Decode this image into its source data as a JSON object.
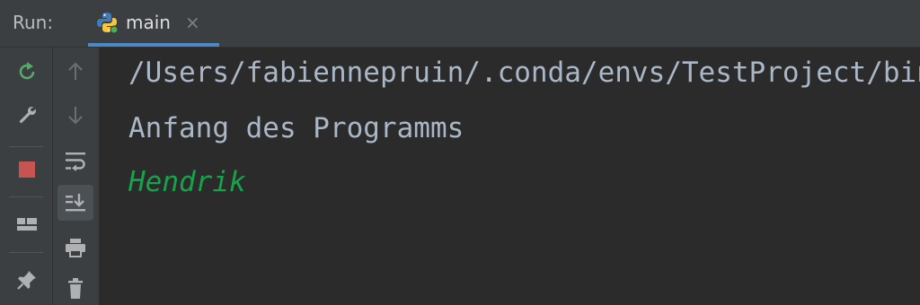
{
  "colors": {
    "console_text": "#a9b7c6",
    "user_input": "#17a34a",
    "tab_underline": "#4a88c7",
    "stop": "#c75450",
    "rerun": "#59a869"
  },
  "header": {
    "run_label": "Run:",
    "tab_title": "main",
    "tab_close": "×",
    "tab_icon": "python-icon"
  },
  "toolbar_left": [
    {
      "icon": "rerun-icon"
    },
    {
      "icon": "wrench-icon"
    },
    {
      "icon": "stop-icon"
    },
    {
      "icon": "layout-icon"
    },
    {
      "icon": "pin-icon"
    }
  ],
  "toolbar_right": [
    {
      "icon": "arrow-up-icon"
    },
    {
      "icon": "arrow-down-icon"
    },
    {
      "icon": "soft-wrap-icon"
    },
    {
      "icon": "scroll-to-end-icon"
    },
    {
      "icon": "print-icon"
    },
    {
      "icon": "trash-icon"
    }
  ],
  "console": {
    "lines": [
      {
        "text": "/Users/fabiennepruin/.conda/envs/TestProject/bin/python",
        "kind": "system"
      },
      {
        "text": "Anfang des Programms",
        "kind": "output"
      },
      {
        "text": "Hendrik",
        "kind": "input"
      }
    ]
  }
}
